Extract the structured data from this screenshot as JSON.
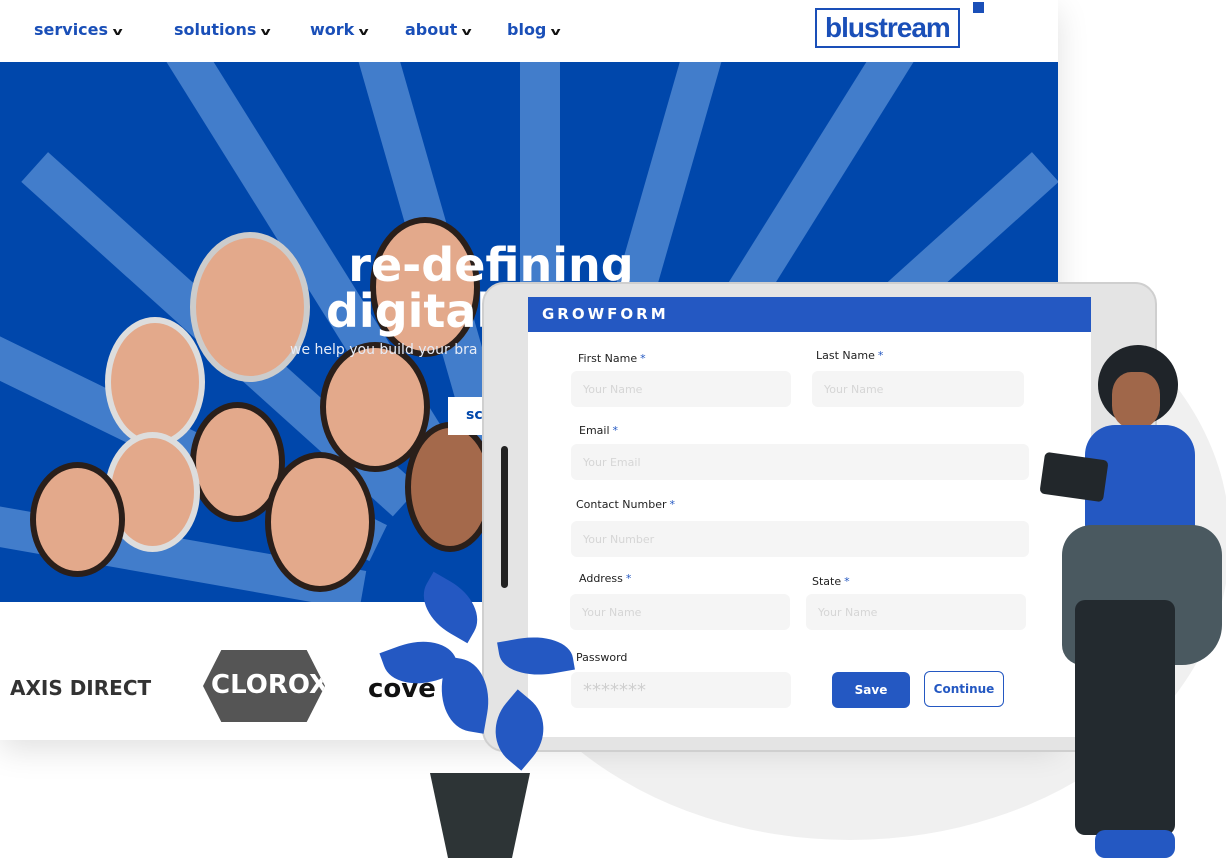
{
  "nav": {
    "items": [
      {
        "label": "services"
      },
      {
        "label": "solutions"
      },
      {
        "label": "work"
      },
      {
        "label": "about"
      },
      {
        "label": "blog"
      }
    ],
    "logo": "blustream"
  },
  "hero": {
    "title_line1": "re-defining",
    "title_line2": "digital a",
    "subtitle": "we help you build your bra",
    "button": "sc"
  },
  "clients": [
    "AXIS DIRECT",
    "CLOROX",
    "cove"
  ],
  "form": {
    "title": "GROWFORM",
    "fields": {
      "first_name": {
        "label": "First Name",
        "placeholder": "Your Name"
      },
      "last_name": {
        "label": "Last Name",
        "placeholder": "Your Name"
      },
      "email": {
        "label": "Email",
        "placeholder": "Your Email"
      },
      "contact": {
        "label": "Contact Number",
        "placeholder": "Your Number"
      },
      "address": {
        "label": "Address",
        "placeholder": "Your Name"
      },
      "state": {
        "label": "State",
        "placeholder": "Your Name"
      },
      "password": {
        "label": "Password",
        "value": "*******"
      }
    },
    "required_mark": "*",
    "save": "Save",
    "continue": "Continue"
  },
  "colors": {
    "brand": "#0047ab",
    "form_accent": "#2458c2"
  }
}
